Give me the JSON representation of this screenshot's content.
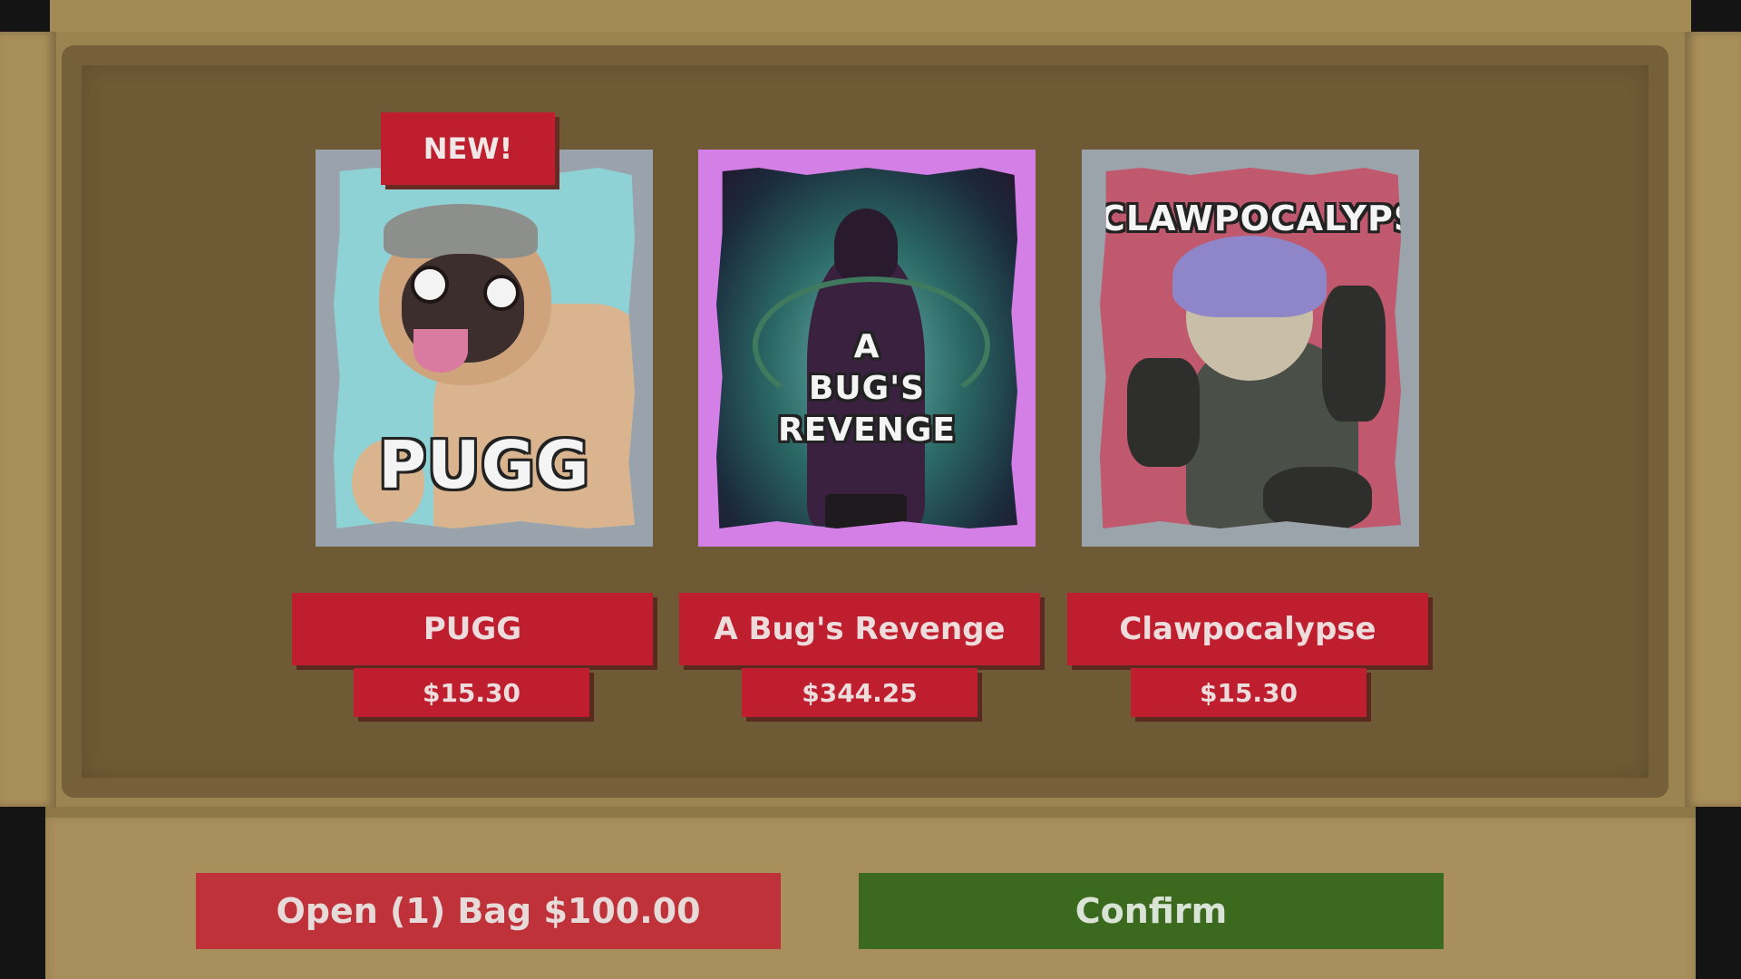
{
  "cards": [
    {
      "art_title": "PUGG",
      "name": "PUGG",
      "price": "$15.30",
      "badge": "NEW!",
      "border_color": "#9aa3ab"
    },
    {
      "art_title_line1": "A",
      "art_title_line2": "BUG'S REVENGE",
      "name": "A Bug's Revenge",
      "price": "$344.25",
      "border_color": "#d37fe6"
    },
    {
      "art_title": "CLAWPOCALYPSE",
      "name": "Clawpocalypse",
      "price": "$15.30",
      "border_color": "#9ba3ab"
    }
  ],
  "actions": {
    "open_label": "Open (1) Bag $100.00",
    "confirm_label": "Confirm"
  },
  "colors": {
    "plate_red": "#be1e2d",
    "open_red": "#c0323a",
    "confirm_green": "#3b6a1f",
    "cardboard": "#a88f5c"
  }
}
